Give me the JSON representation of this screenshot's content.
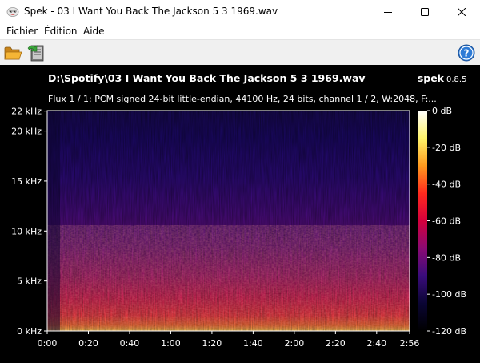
{
  "window": {
    "title": "Spek - 03 I Want You Back The Jackson 5 3 1969.wav"
  },
  "menu": {
    "items": [
      "Fichier",
      "Édition",
      "Aide"
    ]
  },
  "toolbar": {
    "open_icon": "folder-open-icon",
    "save_icon": "save-export-icon",
    "help_icon": "help-icon"
  },
  "spectrogram": {
    "file_path": "D:\\Spotify\\03 I Want You Back The Jackson 5 3 1969.wav",
    "app_name": "spek",
    "app_version": "0.8.5",
    "info": "Flux 1 / 1: PCM signed 24-bit little-endian, 44100 Hz, 24 bits, channel 1 / 2, W:2048, F:...",
    "freq_ticks": [
      {
        "label": "22 kHz",
        "khz": 22
      },
      {
        "label": "20 kHz",
        "khz": 20
      },
      {
        "label": "15 kHz",
        "khz": 15
      },
      {
        "label": "10 kHz",
        "khz": 10
      },
      {
        "label": "5 kHz",
        "khz": 5
      },
      {
        "label": "0 kHz",
        "khz": 0
      }
    ],
    "time_ticks": [
      {
        "label": "0:00",
        "s": 0
      },
      {
        "label": "0:20",
        "s": 20
      },
      {
        "label": "0:40",
        "s": 40
      },
      {
        "label": "1:00",
        "s": 60
      },
      {
        "label": "1:20",
        "s": 80
      },
      {
        "label": "1:40",
        "s": 100
      },
      {
        "label": "2:00",
        "s": 120
      },
      {
        "label": "2:20",
        "s": 140
      },
      {
        "label": "2:40",
        "s": 160
      },
      {
        "label": "2:56",
        "s": 176
      }
    ],
    "db_ticks": [
      {
        "label": "0 dB",
        "db": 0
      },
      {
        "label": "-20 dB",
        "db": -20
      },
      {
        "label": "-40 dB",
        "db": -40
      },
      {
        "label": "-60 dB",
        "db": -60
      },
      {
        "label": "-80 dB",
        "db": -80
      },
      {
        "label": "-100 dB",
        "db": -100
      },
      {
        "label": "-120 dB",
        "db": -120
      }
    ],
    "duration_s": 176,
    "max_khz": 22.05,
    "db_range": [
      -120,
      0
    ],
    "palette": [
      "#ffffff",
      "#fff46a",
      "#ff9a1e",
      "#ff2a1e",
      "#d4003c",
      "#8a0a73",
      "#3a0c7c",
      "#0a0533",
      "#000000"
    ]
  }
}
